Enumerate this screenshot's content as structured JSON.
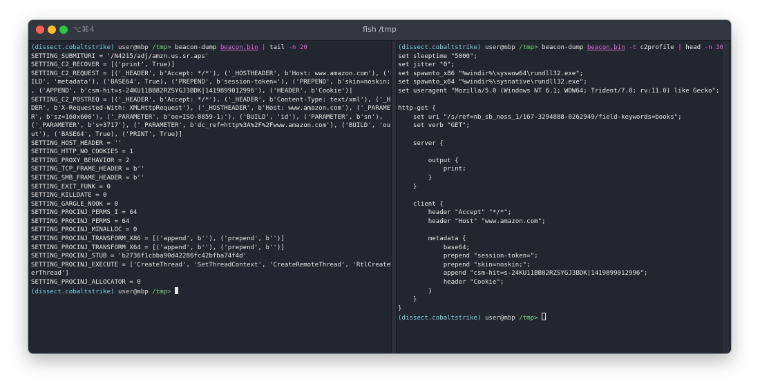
{
  "window": {
    "shortcut": "⌥⌘4",
    "title": "fish /tmp"
  },
  "left_pane": {
    "prompt": {
      "env": "(dissect.cobaltstrike)",
      "user": "user@mbp",
      "path": "/tmp>",
      "command": "beacon-dump",
      "file": "beacon.bin",
      "pipe": "|",
      "rest_cmd": "tail",
      "flag": "-n",
      "arg": "20"
    },
    "output": "SETTING_SUBMITURI = '/N4215/adj/amzn.us.sr.aps'\nSETTING_C2_RECOVER = [('print', True)]\nSETTING_C2_REQUEST = [('_HEADER', b'Accept: */*'), ('_HOSTHEADER', b'Host: www.amazon.com'), ('BU\nILD', 'metadata'), ('BASE64', True), ('PREPEND', b'session-token='), ('PREPEND', b'skin=noskin;')\n, ('APPEND', b'csm-hit=s-24KU11BB82RZSYGJ3BDK|1419899012996'), ('HEADER', b'Cookie')]\nSETTING_C2_POSTREQ = [('_HEADER', b'Accept: */*'), ('_HEADER', b'Content-Type: text/xml'), ('_HEA\nDER', b'X-Requested-With: XMLHttpRequest'), ('_HOSTHEADER', b'Host: www.amazon.com'), ('_PARAMETE\nR', b'sz=160x600'), ('_PARAMETER', b'oe=ISO-8859-1;'), ('BUILD', 'id'), ('PARAMETER', b'sn'),\n('_PARAMETER', b's=3717'), ('_PARAMETER', b'dc_ref=http%3A%2F%2Fwww.amazon.com'), ('BUILD', 'outp\nut'), ('BASE64', True), ('PRINT', True)]\nSETTING_HOST_HEADER = ''\nSETTING_HTTP_NO_COOKIES = 1\nSETTING_PROXY_BEHAVIOR = 2\nSETTING_TCP_FRAME_HEADER = b''\nSETTING_SMB_FRAME_HEADER = b''\nSETTING_EXIT_FUNK = 0\nSETTING_KILLDATE = 0\nSETTING_GARGLE_NOOK = 0\nSETTING_PROCINJ_PERMS_I = 64\nSETTING_PROCINJ_PERMS = 64\nSETTING_PROCINJ_MINALLOC = 0\nSETTING_PROCINJ_TRANSFORM_X86 = [('append', b''), ('prepend', b'')]\nSETTING_PROCINJ_TRANSFORM_X64 = [('append', b''), ('prepend', b'')]\nSETTING_PROCINJ_STUB = 'b2736f1cbba90d42286fc42bfba74f4d'\nSETTING_PROCINJ_EXECUTE = ['CreateThread', 'SetThreadContext', 'CreateRemoteThread', 'RtlCreateUs\nerThread']\nSETTING_PROCINJ_ALLOCATOR = 0",
    "end_prompt": {
      "env": "(dissect.cobaltstrike)",
      "user": "user@mbp",
      "path": "/tmp>"
    }
  },
  "right_pane": {
    "prompt": {
      "env": "(dissect.cobaltstrike)",
      "user": "user@mbp",
      "path": "/tmp>",
      "command": "beacon-dump",
      "file": "beacon.bin",
      "flag1": "-t",
      "arg1": "c2profile",
      "pipe": "|",
      "rest_cmd": "head",
      "flag2": "-n",
      "arg2": "30"
    },
    "output": "set sleeptime \"5000\";\nset jitter \"0\";\nset spawnto_x86 \"%windir%\\syswow64\\rundll32.exe\";\nset spawnto_x64 \"%windir%\\sysnative\\rundll32.exe\";\nset useragent \"Mozilla/5.0 (Windows NT 6.1; WOW64; Trident/7.0; rv:11.0) like Gecko\";\n\nhttp-get {\n    set uri \"/s/ref=nb_sb_noss_1/167-3294888-0262949/field-keywords=books\";\n    set verb \"GET\";\n\n    server {\n\n        output {\n            print;\n        }\n    }\n\n    client {\n        header \"Accept\" \"*/*\";\n        header \"Host\" \"www.amazon.com\";\n\n        metadata {\n            base64;\n            prepend \"session-token=\";\n            prepend \"skin=noskin;\";\n            append \"csm-hit=s-24KU11BB82RZSYGJ3BDK|1419899012996\";\n            header \"Cookie\";\n        }\n    }\n}",
    "end_prompt": {
      "env": "(dissect.cobaltstrike)",
      "user": "user@mbp",
      "path": "/tmp>"
    }
  }
}
